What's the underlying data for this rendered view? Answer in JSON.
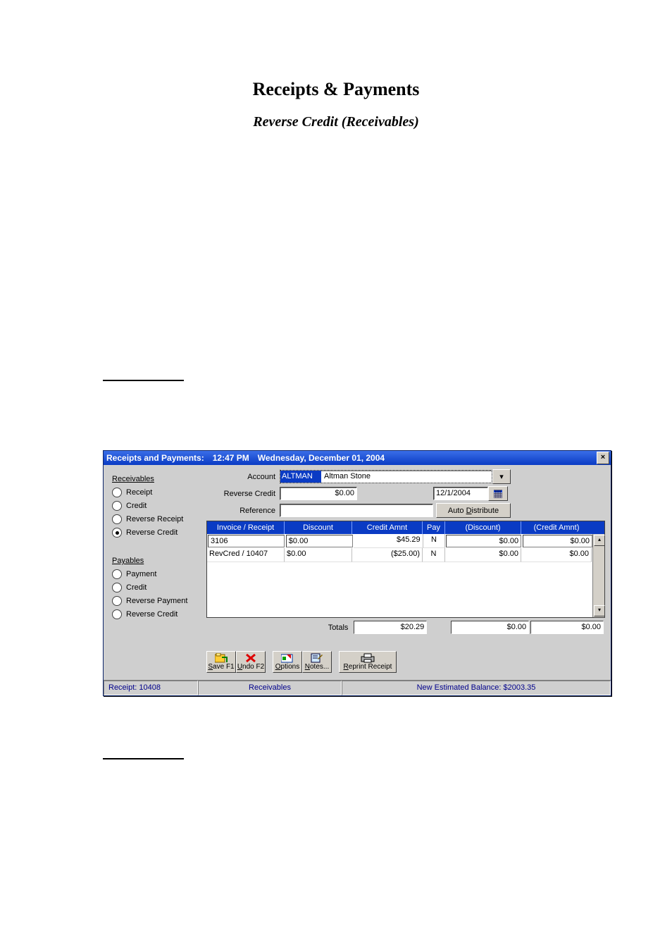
{
  "doc": {
    "title": "Receipts & Payments",
    "subtitle": "Reverse Credit (Receivables)"
  },
  "titlebar": {
    "app": "Receipts and Payments:",
    "time": "12:47 PM",
    "date": "Wednesday, December 01, 2004"
  },
  "sidebar": {
    "receivables_head": "Receivables",
    "payables_head": "Payables",
    "recv_options": [
      "Receipt",
      "Credit",
      "Reverse Receipt",
      "Reverse Credit"
    ],
    "recv_selected": 3,
    "pay_options": [
      "Payment",
      "Credit",
      "Reverse Payment",
      "Reverse Credit"
    ]
  },
  "form": {
    "account_label": "Account",
    "account_code": "ALTMAN",
    "account_name": "Altman Stone",
    "reverse_credit_label": "Reverse Credit",
    "reverse_credit_value": "$0.00",
    "date_value": "12/1/2004",
    "reference_label": "Reference",
    "reference_value": "",
    "auto_distribute": "Auto Distribute"
  },
  "grid": {
    "headers": [
      "Invoice / Receipt",
      "Discount",
      "Credit Amnt",
      "Pay",
      "(Discount)",
      "(Credit Amnt)"
    ],
    "rows": [
      {
        "invoice": "3106",
        "discount": "$0.00",
        "credit_amnt": "$45.29",
        "pay": "N",
        "disc2": "$0.00",
        "amt2": "$0.00"
      },
      {
        "invoice": "RevCred / 10407",
        "discount": "$0.00",
        "credit_amnt": "($25.00)",
        "pay": "N",
        "disc2": "$0.00",
        "amt2": "$0.00"
      }
    ],
    "totals_label": "Totals",
    "totals": {
      "credit_amnt": "$20.29",
      "disc2": "$0.00",
      "amt2": "$0.00"
    }
  },
  "toolbar": {
    "save": "Save F1",
    "undo": "Undo F2",
    "options": "Options",
    "notes": "Notes...",
    "reprint": "Reprint Receipt"
  },
  "status": {
    "receipt": "Receipt: 10408",
    "module": "Receivables",
    "balance": "New Estimated Balance:  $2003.35"
  }
}
